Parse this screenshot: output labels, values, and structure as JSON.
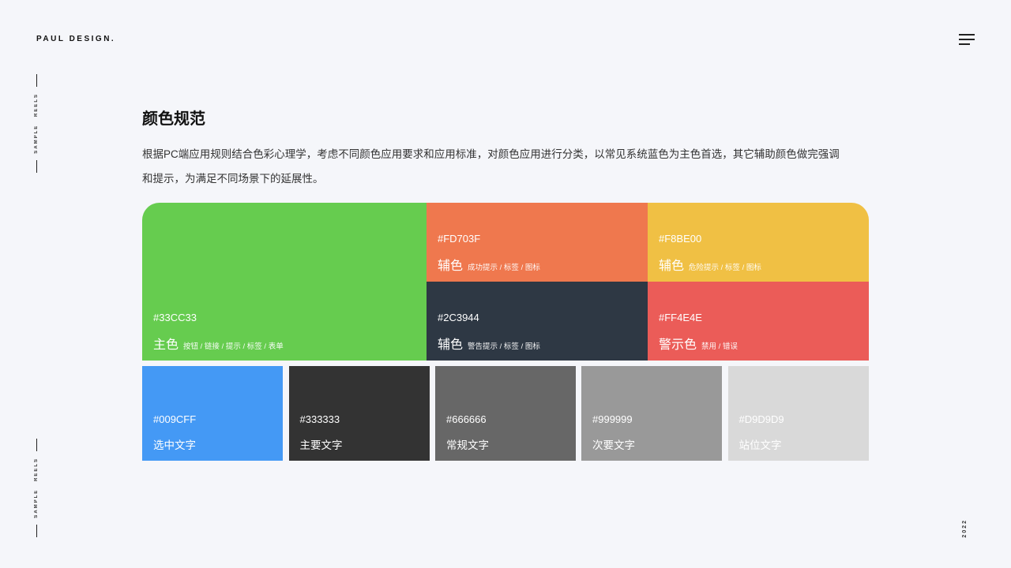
{
  "brand": "PAUL DESIGN.",
  "side_text": "SAMPLE REELS",
  "year": "2022",
  "title": "颜色规范",
  "description": "根据PC端应用规则结合色彩心理学，考虑不同颜色应用要求和应用标准，对颜色应用进行分类，以常见系统蓝色为主色首选，其它辅助颜色做完强调和提示，为满足不同场景下的延展性。",
  "primary_palette": [
    {
      "hex": "#33CC33",
      "name": "主色",
      "usage": "按钮 / 链接 / 提示 / 标签 / 表单",
      "color": "#66CC4F"
    },
    {
      "hex": "#FD703F",
      "name": "辅色",
      "usage": "成功提示 / 标签 / 图标",
      "color": "#EF784E"
    },
    {
      "hex": "#F8BE00",
      "name": "辅色",
      "usage": "危险提示 / 标签 / 图标",
      "color": "#F0C044"
    },
    {
      "hex": "#2C3944",
      "name": "辅色",
      "usage": "警告提示 / 标签 / 图标",
      "color": "#2E3844"
    },
    {
      "hex": "#FF4E4E",
      "name": "警示色",
      "usage": "禁用 / 错误",
      "color": "#EB5C58"
    }
  ],
  "text_palette": [
    {
      "hex": "#009CFF",
      "name": "选中文字",
      "color": "#4499F5"
    },
    {
      "hex": "#333333",
      "name": "主要文字",
      "color": "#333333"
    },
    {
      "hex": "#666666",
      "name": "常规文字",
      "color": "#676767"
    },
    {
      "hex": "#999999",
      "name": "次要文字",
      "color": "#999999"
    },
    {
      "hex": "#D9D9D9",
      "name": "站位文字",
      "color": "#D9D9D9"
    }
  ]
}
